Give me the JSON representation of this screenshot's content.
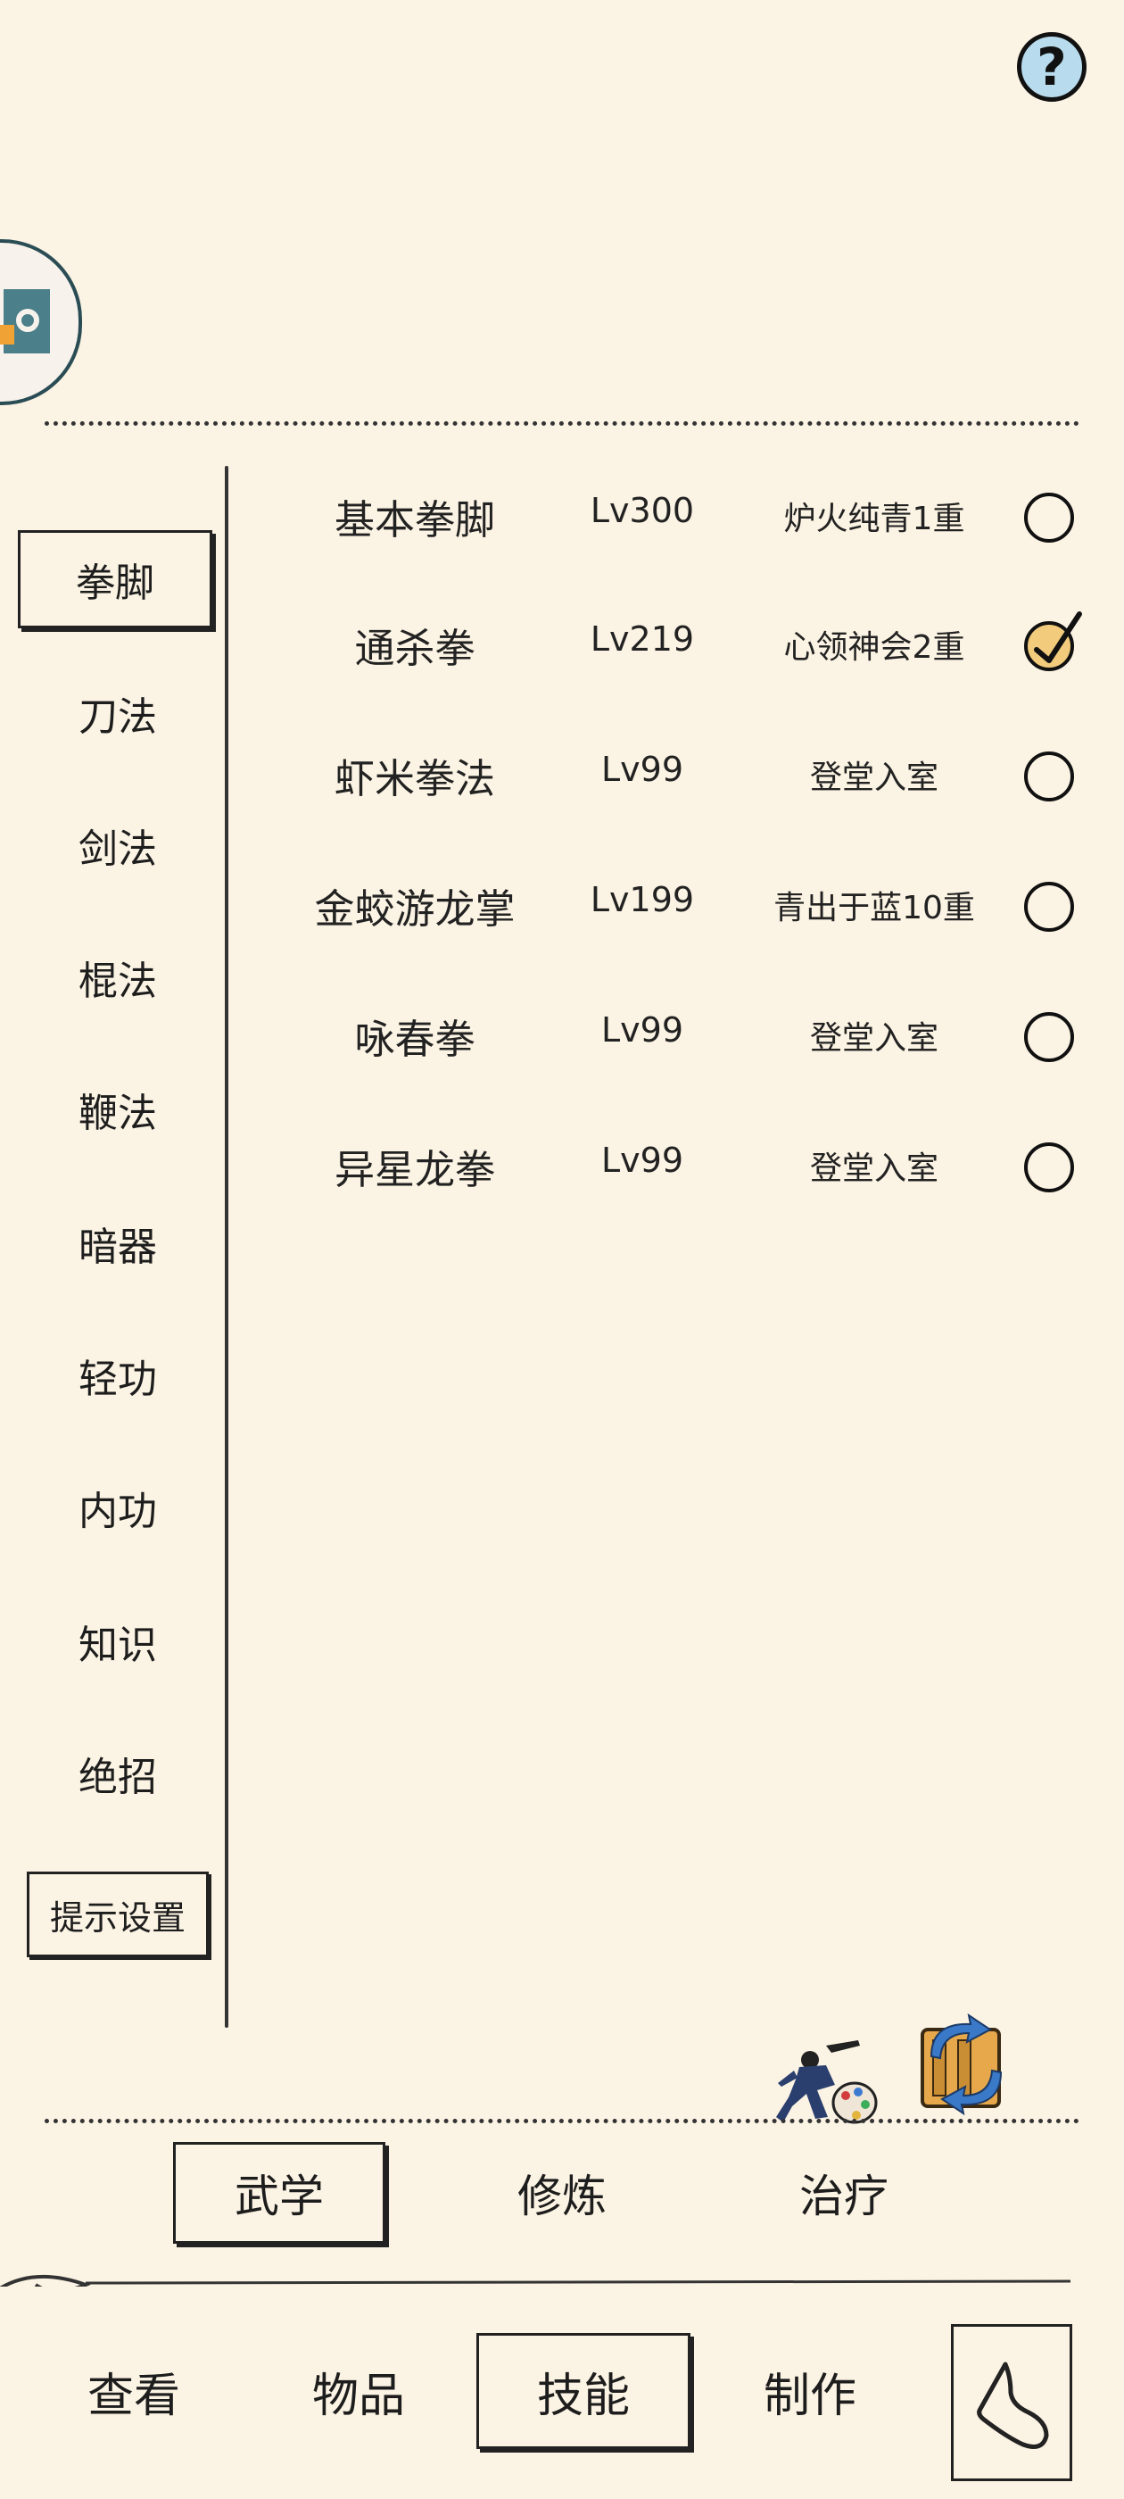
{
  "header": {
    "help_icon": "question-mark-icon",
    "avatar_icon": "logo-icon"
  },
  "sidebar": {
    "items": [
      {
        "label": "拳脚",
        "active": true
      },
      {
        "label": "刀法"
      },
      {
        "label": "剑法"
      },
      {
        "label": "棍法"
      },
      {
        "label": "鞭法"
      },
      {
        "label": "暗器"
      },
      {
        "label": "轻功"
      },
      {
        "label": "内功"
      },
      {
        "label": "知识"
      },
      {
        "label": "绝招"
      }
    ],
    "hint_button": "提示设置"
  },
  "skills": [
    {
      "name": "基本拳脚",
      "level": "Lv300",
      "rank": "炉火纯青1重",
      "checked": false
    },
    {
      "name": "通杀拳",
      "level": "Lv219",
      "rank": "心领神会2重",
      "checked": true
    },
    {
      "name": "虾米拳法",
      "level": "Lv99",
      "rank": "登堂入室",
      "checked": false
    },
    {
      "name": "金蛟游龙掌",
      "level": "Lv199",
      "rank": "青出于蓝10重",
      "checked": false
    },
    {
      "name": "咏春拳",
      "level": "Lv99",
      "rank": "登堂入室",
      "checked": false
    },
    {
      "name": "异星龙拳",
      "level": "Lv99",
      "rank": "登堂入室",
      "checked": false
    }
  ],
  "subtabs": [
    {
      "label": "武学",
      "active": true
    },
    {
      "label": "修炼"
    },
    {
      "label": "治疗"
    }
  ],
  "nav": [
    {
      "label": "查看"
    },
    {
      "label": "物品"
    },
    {
      "label": "技能",
      "active": true
    },
    {
      "label": "制作"
    }
  ],
  "colors": {
    "background": "#fbf3e3",
    "checked_fill": "#f2cc7c",
    "help_fill": "#b8dcee"
  }
}
